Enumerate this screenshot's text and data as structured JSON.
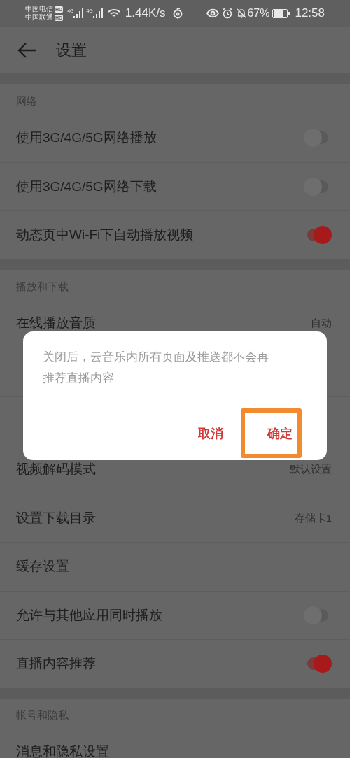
{
  "status_bar": {
    "carriers": [
      {
        "name": "中国电信",
        "badge": "HD"
      },
      {
        "name": "中国联通",
        "badge": "HD"
      }
    ],
    "net_labels": [
      "4G",
      "4G"
    ],
    "speed": "1.44K/s",
    "battery": "67%",
    "time": "12:58"
  },
  "header": {
    "title": "设置"
  },
  "sections": [
    {
      "title": "网络",
      "rows": [
        {
          "kind": "toggle",
          "label": "使用3G/4G/5G网络播放",
          "on": false
        },
        {
          "kind": "toggle",
          "label": "使用3G/4G/5G网络下载",
          "on": false
        },
        {
          "kind": "toggle",
          "label": "动态页中Wi-Fi下自动播放视频",
          "on": true
        }
      ]
    },
    {
      "title": "播放和下载",
      "rows": [
        {
          "kind": "value",
          "label": "在线播放音质",
          "value": "自动"
        },
        {
          "kind": "covered"
        },
        {
          "kind": "covered"
        },
        {
          "kind": "value",
          "label": "视频解码模式",
          "value": "默认设置"
        },
        {
          "kind": "value",
          "label": "设置下载目录",
          "value": "存储卡1"
        },
        {
          "kind": "link",
          "label": "缓存设置"
        },
        {
          "kind": "toggle",
          "label": "允许与其他应用同时播放",
          "on": false
        },
        {
          "kind": "toggle",
          "label": "直播内容推荐",
          "on": true
        }
      ]
    },
    {
      "title": "帐号和隐私",
      "rows": [
        {
          "kind": "link",
          "label": "消息和隐私设置"
        }
      ]
    }
  ],
  "dialog": {
    "message": "关闭后，云音乐内所有页面及推送都不会再推荐直播内容",
    "buttons": [
      {
        "label": "取消",
        "highlighted": false
      },
      {
        "label": "确定",
        "highlighted": true
      }
    ]
  }
}
